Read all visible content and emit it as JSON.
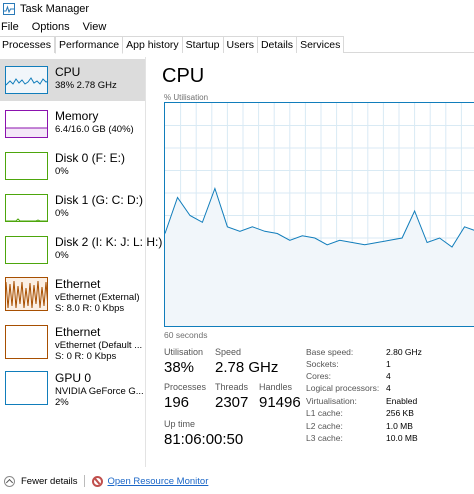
{
  "window": {
    "title": "Task Manager",
    "icon": "task-manager-icon"
  },
  "menu": [
    "File",
    "Options",
    "View"
  ],
  "tabs": [
    "Processes",
    "Performance",
    "App history",
    "Startup",
    "Users",
    "Details",
    "Services"
  ],
  "active_tab": "Performance",
  "sidebar": [
    {
      "name": "CPU",
      "sub1": "38% 2.78 GHz",
      "sub2": "",
      "color": "#117dbb",
      "selected": true
    },
    {
      "name": "Memory",
      "sub1": "6.4/16.0 GB (40%)",
      "sub2": "",
      "color": "#8b12ae",
      "selected": false
    },
    {
      "name": "Disk 0 (F: E:)",
      "sub1": "0%",
      "sub2": "",
      "color": "#4da60c",
      "selected": false
    },
    {
      "name": "Disk 1 (G: C: D:)",
      "sub1": "0%",
      "sub2": "",
      "color": "#4da60c",
      "selected": false
    },
    {
      "name": "Disk 2 (I: K: J: L: H:)",
      "sub1": "0%",
      "sub2": "",
      "color": "#4da60c",
      "selected": false
    },
    {
      "name": "Ethernet",
      "sub1": "vEthernet (External)",
      "sub2": "S: 8.0  R: 0 Kbps",
      "color": "#a74f01",
      "selected": false
    },
    {
      "name": "Ethernet",
      "sub1": "vEthernet (Default ...",
      "sub2": "S: 0  R: 0 Kbps",
      "color": "#a74f01",
      "selected": false
    },
    {
      "name": "GPU 0",
      "sub1": "NVIDIA GeForce G...",
      "sub2": "2%",
      "color": "#117dbb",
      "selected": false
    }
  ],
  "main": {
    "title": "CPU",
    "graph_label": "% Utilisation",
    "time_label": "60 seconds",
    "stats": {
      "utilisation_label": "Utilisation",
      "utilisation": "38%",
      "speed_label": "Speed",
      "speed": "2.78 GHz",
      "processes_label": "Processes",
      "processes": "196",
      "threads_label": "Threads",
      "threads": "2307",
      "handles_label": "Handles",
      "handles": "91496",
      "uptime_label": "Up time",
      "uptime": "81:06:00:50"
    },
    "specs": [
      {
        "label": "Base speed:",
        "value": "2.80 GHz"
      },
      {
        "label": "Sockets:",
        "value": "1"
      },
      {
        "label": "Cores:",
        "value": "4"
      },
      {
        "label": "Logical processors:",
        "value": "4"
      },
      {
        "label": "Virtualisation:",
        "value": "Enabled"
      },
      {
        "label": "L1 cache:",
        "value": "256 KB"
      },
      {
        "label": "L2 cache:",
        "value": "1.0 MB"
      },
      {
        "label": "L3 cache:",
        "value": "10.0 MB"
      }
    ]
  },
  "cpu_history": {
    "unit": "% utilisation",
    "values": [
      42,
      58,
      50,
      47,
      62,
      45,
      43,
      45,
      43,
      42,
      39,
      41,
      40,
      37,
      39,
      38,
      37,
      38,
      39,
      40,
      52,
      38,
      40,
      36,
      45,
      43
    ]
  },
  "footer": {
    "fewer_details": "Fewer details",
    "open_monitor": "Open Resource Monitor"
  },
  "colors": {
    "cpu": "#117dbb",
    "memory": "#8b12ae",
    "disk": "#4da60c",
    "ethernet": "#a74f01",
    "link": "#1a66c7"
  }
}
